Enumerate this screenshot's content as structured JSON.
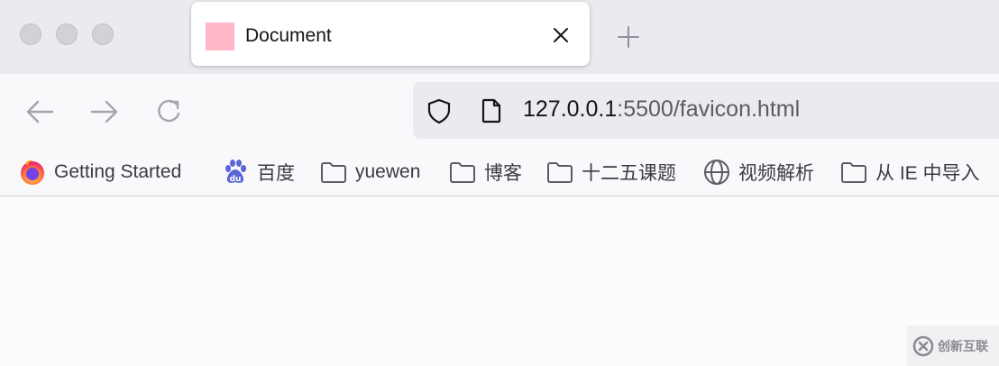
{
  "window": {
    "traffic_lights": [
      "close",
      "minimize",
      "maximize"
    ]
  },
  "tab": {
    "title": "Document",
    "favicon_color": "#ffb6c6",
    "close_icon": "close-icon",
    "new_tab_icon": "plus-icon"
  },
  "nav": {
    "back_icon": "arrow-left-icon",
    "forward_icon": "arrow-right-icon",
    "reload_icon": "reload-icon",
    "url_host": "127.0.0.1",
    "url_rest": ":5500/favicon.html"
  },
  "bookmarks": [
    {
      "label": "Getting Started",
      "icon": "firefox-icon"
    },
    {
      "label": "百度",
      "icon": "baidu-icon"
    },
    {
      "label": "yuewen",
      "icon": "folder-icon"
    },
    {
      "label": "博客",
      "icon": "folder-icon"
    },
    {
      "label": "十二五课题",
      "icon": "folder-icon"
    },
    {
      "label": "视频解析",
      "icon": "globe-icon"
    },
    {
      "label": "从 IE 中导入",
      "icon": "folder-icon"
    }
  ],
  "watermark": {
    "text": "创新互联"
  }
}
